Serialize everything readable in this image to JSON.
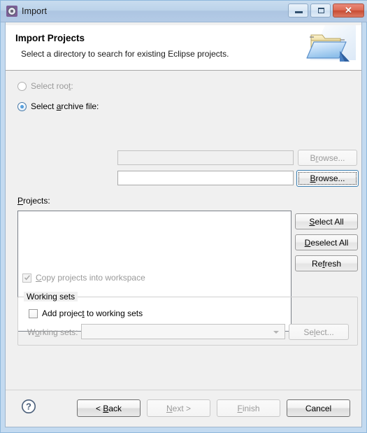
{
  "window": {
    "title": "Import",
    "app_icon": "gear-icon",
    "controls": {
      "minimize": "minimize-icon",
      "maximize": "maximize-icon",
      "close": "✕"
    }
  },
  "banner": {
    "title": "Import Projects",
    "subtitle": "Select a directory to search for existing Eclipse projects.",
    "icon": "open-folder-icon"
  },
  "source": {
    "root_directory": {
      "label_pre": "Select roo",
      "label_mnemonic": "t",
      "label_post": ":",
      "selected": false,
      "value": "",
      "browse_label_pre": "B",
      "browse_mnemonic": "r",
      "browse_label_post": "owse...",
      "enabled": false
    },
    "archive_file": {
      "label_pre": "Select ",
      "label_mnemonic": "a",
      "label_post": "rchive file:",
      "selected": true,
      "value": "",
      "browse_label_pre": "",
      "browse_mnemonic": "B",
      "browse_label_post": "rowse...",
      "enabled": true,
      "focused": true
    }
  },
  "projects": {
    "label_mnemonic": "P",
    "label_post": "rojects:",
    "items": [],
    "buttons": [
      {
        "pre": "",
        "mnemonic": "S",
        "post": "elect All",
        "name": "select-all-button",
        "enabled": true
      },
      {
        "pre": "",
        "mnemonic": "D",
        "post": "eselect All",
        "name": "deselect-all-button",
        "enabled": true
      },
      {
        "pre": "Re",
        "mnemonic": "f",
        "post": "resh",
        "name": "refresh-button",
        "enabled": true
      }
    ]
  },
  "options": {
    "copy_projects": {
      "pre": "",
      "mnemonic": "C",
      "post": "opy projects into workspace",
      "checked": true,
      "enabled": false
    }
  },
  "working_sets": {
    "group_label": "Working sets",
    "add_checkbox": {
      "pre": "Add projec",
      "mnemonic": "t",
      "post": " to working sets",
      "checked": false,
      "enabled": true
    },
    "combo_label_pre": "W",
    "combo_label_mnemonic": "o",
    "combo_label_post": "rking sets:",
    "combo_value": "",
    "select_button_pre": "Se",
    "select_button_mnemonic": "l",
    "select_button_post": "ect...",
    "enabled": false
  },
  "footer": {
    "help": "?",
    "buttons": [
      {
        "pre": "< ",
        "mnemonic": "B",
        "post": "ack",
        "name": "back-button",
        "enabled": true,
        "strong": true
      },
      {
        "pre": "",
        "mnemonic": "N",
        "post": "ext >",
        "name": "next-button",
        "enabled": false,
        "strong": false
      },
      {
        "pre": "",
        "mnemonic": "F",
        "post": "inish",
        "name": "finish-button",
        "enabled": false,
        "strong": false
      },
      {
        "pre": "Cancel",
        "mnemonic": "",
        "post": "",
        "name": "cancel-button",
        "enabled": true,
        "strong": true
      }
    ]
  },
  "colors": {
    "titlebar": "#adc5e2",
    "frame": "#c3daf0",
    "body": "#f0f0f0",
    "banner": "#ffffff",
    "accent_blue": "#1d6fb8",
    "close_red": "#c74b33"
  }
}
